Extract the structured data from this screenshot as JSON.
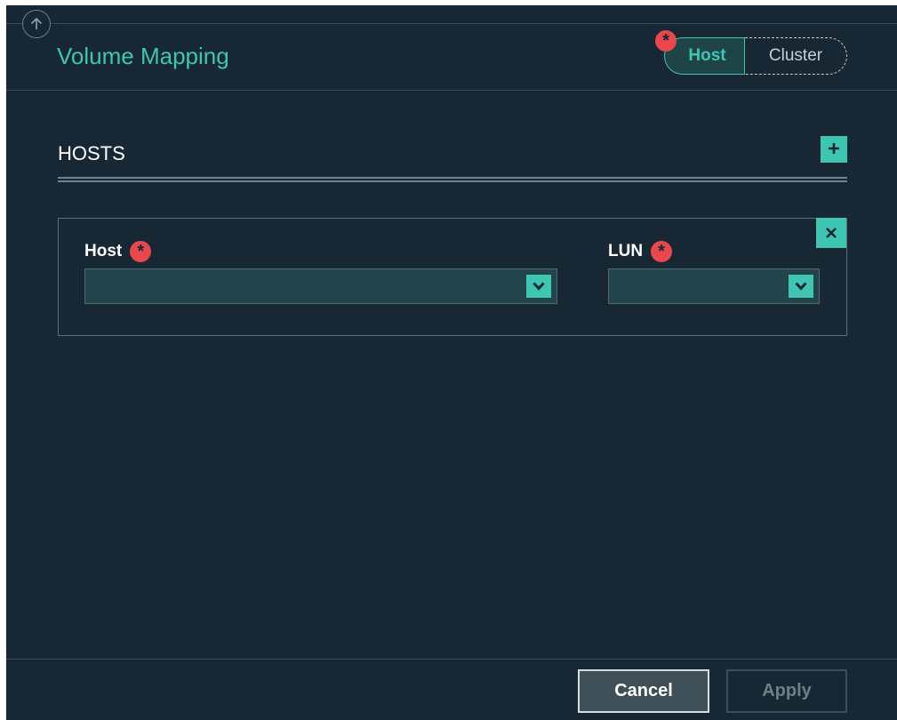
{
  "dialog": {
    "title": "Volume Mapping",
    "mode_toggle": {
      "options": [
        "Host",
        "Cluster"
      ],
      "selected": "Host"
    }
  },
  "hosts_section": {
    "title": "HOSTS",
    "mappings": [
      {
        "host": {
          "label": "Host",
          "value": ""
        },
        "lun": {
          "label": "LUN",
          "value": ""
        }
      }
    ]
  },
  "footer": {
    "cancel_label": "Cancel",
    "apply_label": "Apply"
  },
  "colors": {
    "background": "#172733",
    "accent": "#3ec6b3",
    "required": "#e8484b"
  },
  "icons": {
    "collapse": "arrow-up-circle-icon",
    "required": "asterisk-icon",
    "add": "plus-icon",
    "remove": "close-icon",
    "dropdown": "chevron-down-icon"
  }
}
